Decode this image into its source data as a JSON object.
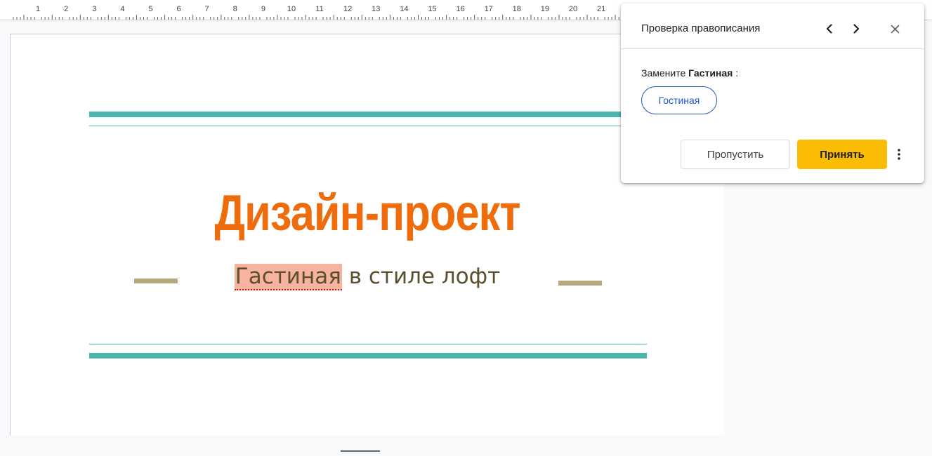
{
  "ruler": {
    "numbers": [
      "1",
      "2",
      "3",
      "4",
      "5",
      "6",
      "7",
      "8",
      "9",
      "10",
      "11",
      "12",
      "13",
      "14",
      "15",
      "16",
      "17",
      "18",
      "19",
      "20",
      "21"
    ]
  },
  "slide": {
    "title": "Дизайн-проект",
    "subtitle_misspelled": "Гастиная",
    "subtitle_rest": " в стиле лофт"
  },
  "spellcheck": {
    "title": "Проверка правописания",
    "replace_prefix": "Замените ",
    "replace_word": "Гастиная",
    "replace_suffix": " :",
    "suggestion": "Гостиная",
    "skip_label": "Пропустить",
    "accept_label": "Принять"
  },
  "colors": {
    "title": "#ee6c0c",
    "accent_line": "#4db6ac",
    "accept_button": "#fbbc04",
    "suggestion": "#1a56c9"
  }
}
